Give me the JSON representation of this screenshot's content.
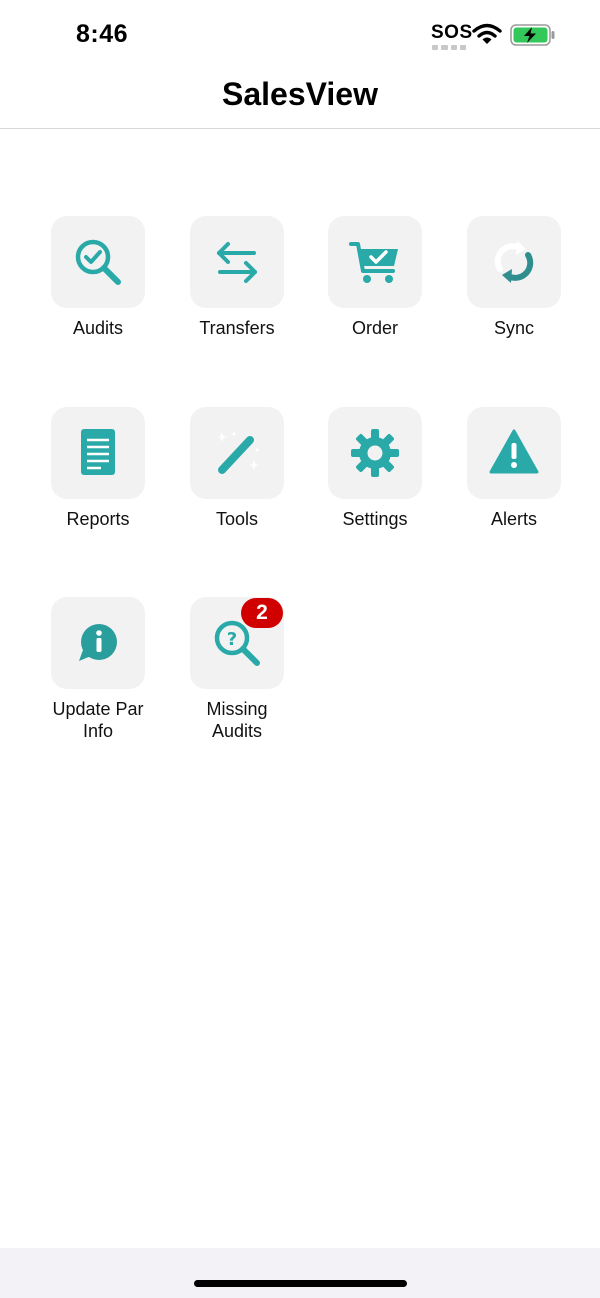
{
  "status_bar": {
    "time": "8:46",
    "carrier": "SOS",
    "wifi_icon": "wifi-icon",
    "battery_icon": "battery-charging-icon"
  },
  "nav": {
    "title": "SalesView"
  },
  "accent_color": "#2aa9a9",
  "tiles": [
    {
      "label": "Audits",
      "icon": "magnifier-check-icon"
    },
    {
      "label": "Transfers",
      "icon": "transfer-arrows-icon"
    },
    {
      "label": "Order",
      "icon": "cart-check-icon"
    },
    {
      "label": "Sync",
      "icon": "sync-icon"
    },
    {
      "label": "Reports",
      "icon": "document-icon"
    },
    {
      "label": "Tools",
      "icon": "magic-wand-icon"
    },
    {
      "label": "Settings",
      "icon": "gear-icon"
    },
    {
      "label": "Alerts",
      "icon": "warning-icon"
    },
    {
      "label": "Update Par\nInfo",
      "icon": "info-bubble-icon"
    },
    {
      "label": "Missing\nAudits",
      "icon": "magnifier-question-icon",
      "badge": "2"
    }
  ]
}
